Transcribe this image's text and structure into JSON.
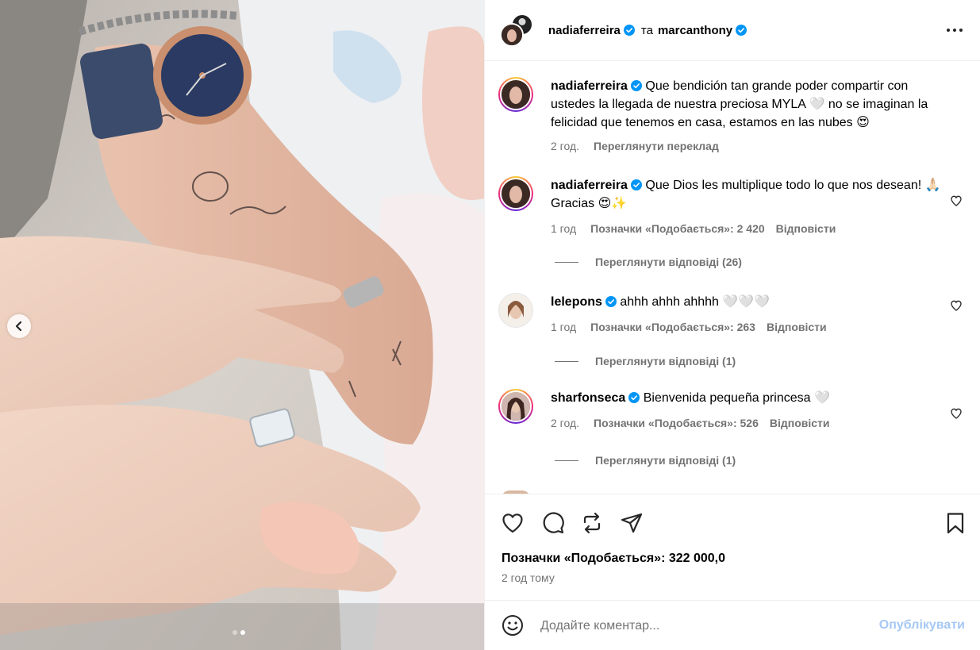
{
  "post": {
    "header": {
      "author": "nadiaferreira",
      "joiner": "та",
      "coauthor": "marcanthony"
    },
    "caption": {
      "username": "nadiaferreira",
      "text": "Que bendición tan grande poder compartir con ustedes la llegada de nuestra preciosa MYLA 🤍 no se imaginan la felicidad que tenemos en casa, estamos en las nubes 😍",
      "time": "2 год.",
      "see_translation": "Переглянути переклад"
    },
    "comments": [
      {
        "username": "nadiaferreira",
        "text": "Que Dios les multiplique todo lo que nos desean! 🙏🏻 Gracias 😍✨",
        "time": "1 год",
        "likes": "Позначки «Подобається»: 2 420",
        "reply": "Відповісти",
        "view_replies": "Переглянути відповіді (26)"
      },
      {
        "username": "lelepons",
        "text": "ahhh ahhh ahhhh 🤍🤍🤍",
        "time": "1 год",
        "likes": "Позначки «Подобається»: 263",
        "reply": "Відповісти",
        "view_replies": "Переглянути відповіді (1)"
      },
      {
        "username": "sharfonseca",
        "text": "Bienvenida pequeña princesa 🤍",
        "time": "2 год.",
        "likes": "Позначки «Подобається»: 526",
        "reply": "Відповісти",
        "view_replies": "Переглянути відповіді (1)"
      }
    ],
    "likes_total": "Позначки «Подобається»: 322 000,0",
    "posted_ago": "2 год тому",
    "add_comment": {
      "placeholder": "Додайте коментар...",
      "post_label": "Опублікувати"
    },
    "icons": {
      "more": "more-options-icon",
      "like": "heart-icon",
      "comment": "comment-icon",
      "repost": "repost-icon",
      "share": "send-icon",
      "save": "bookmark-icon",
      "emoji": "emoji-icon",
      "prev": "chevron-left-icon",
      "verified": "verified-badge-icon"
    },
    "colors": {
      "verified": "#0095f6",
      "muted_text": "#737373",
      "post_button": "#a6c8f4"
    },
    "carousel": {
      "total": 2,
      "active": 2
    }
  }
}
